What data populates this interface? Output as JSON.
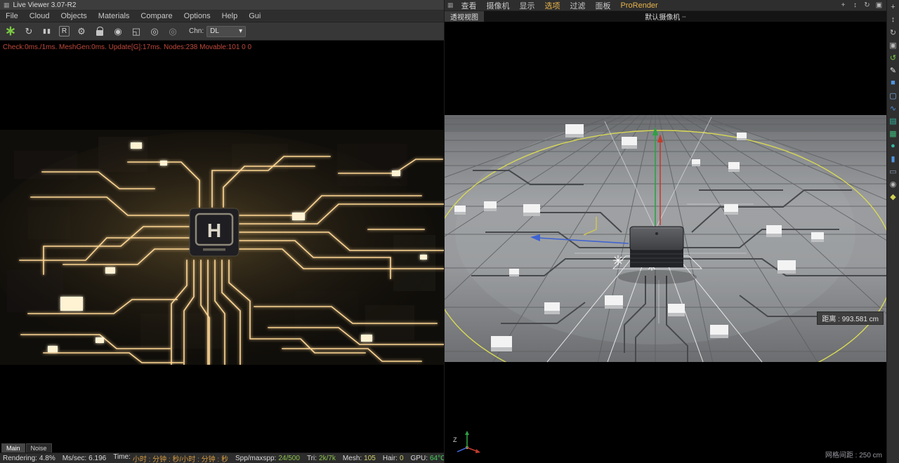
{
  "left_window": {
    "title": "Live Viewer 3.07-R2",
    "menu": [
      "File",
      "Cloud",
      "Objects",
      "Materials",
      "Compare",
      "Options",
      "Help",
      "Gui"
    ],
    "toolbar": {
      "chn_label": "Chn:",
      "channel_value": "DL"
    },
    "stats_line": "Check:0ms./1ms. MeshGen:0ms. Update[G]:17ms. Nodes:238 Movable:101  0 0",
    "render": {
      "chip_logo": "H"
    },
    "tabs": {
      "main": "Main",
      "noise": "Noise"
    },
    "status": {
      "rendering_label": "Rendering:",
      "rendering_value": "4.8%",
      "mssec_label": "Ms/sec:",
      "mssec_value": "6.196",
      "time_label": "Time:",
      "time_value": "小时 : 分钟 : 秒/小时 : 分钟 : 秒",
      "spp_label": "Spp/maxspp:",
      "spp_value": "24/500",
      "tri_label": "Tri:",
      "tri_value": "2k/7k",
      "mesh_label": "Mesh:",
      "mesh_value": "105",
      "hair_label": "Hair:",
      "hair_value": "0",
      "gpu_label": "GPU:",
      "gpu_value": "64°C"
    }
  },
  "viewport": {
    "menu": [
      "查看",
      "摄像机",
      "显示",
      "选项",
      "过滤",
      "面板",
      "ProRender"
    ],
    "tab": "透视视图",
    "camera_label": "默认摄像机",
    "camera_badges": "°°",
    "distance_label": "距离 : 993.581 cm",
    "grid_spacing_label": "网格间距 : 250 cm",
    "axis_label": "Z"
  },
  "icons": {
    "window_grid": "▦",
    "octane_logo": "∗",
    "restart": "↻",
    "pause": "▮▮",
    "reset": "R",
    "gear": "⚙",
    "camera_ball": "◉",
    "region": "◱",
    "picker_white": "◎",
    "picker_gray": "◎",
    "dropdown": "▾",
    "grip": "▦",
    "strip": [
      {
        "name": "pan-view-icon",
        "glyph": "+"
      },
      {
        "name": "zoom-view-icon",
        "glyph": "↕"
      },
      {
        "name": "rotate-view-icon",
        "glyph": "↻"
      },
      {
        "name": "toggle-panels-icon",
        "glyph": "▣"
      },
      {
        "name": "coordinate-system-icon",
        "glyph": "↺"
      },
      {
        "name": "pen-tool-icon",
        "glyph": "✎"
      },
      {
        "name": "cube-primitive-icon",
        "glyph": "■"
      },
      {
        "name": "rounded-cube-icon",
        "glyph": "▢"
      },
      {
        "name": "spline-icon",
        "glyph": "∿"
      },
      {
        "name": "subdivision-icon",
        "glyph": "▤"
      },
      {
        "name": "array-icon",
        "glyph": "▦"
      },
      {
        "name": "sphere-primitive-icon",
        "glyph": "●"
      },
      {
        "name": "cylinder-icon",
        "glyph": "▮"
      },
      {
        "name": "plane-icon",
        "glyph": "▭"
      },
      {
        "name": "camera-object-icon",
        "glyph": "◉"
      },
      {
        "name": "light-object-icon",
        "glyph": "◆"
      }
    ]
  }
}
